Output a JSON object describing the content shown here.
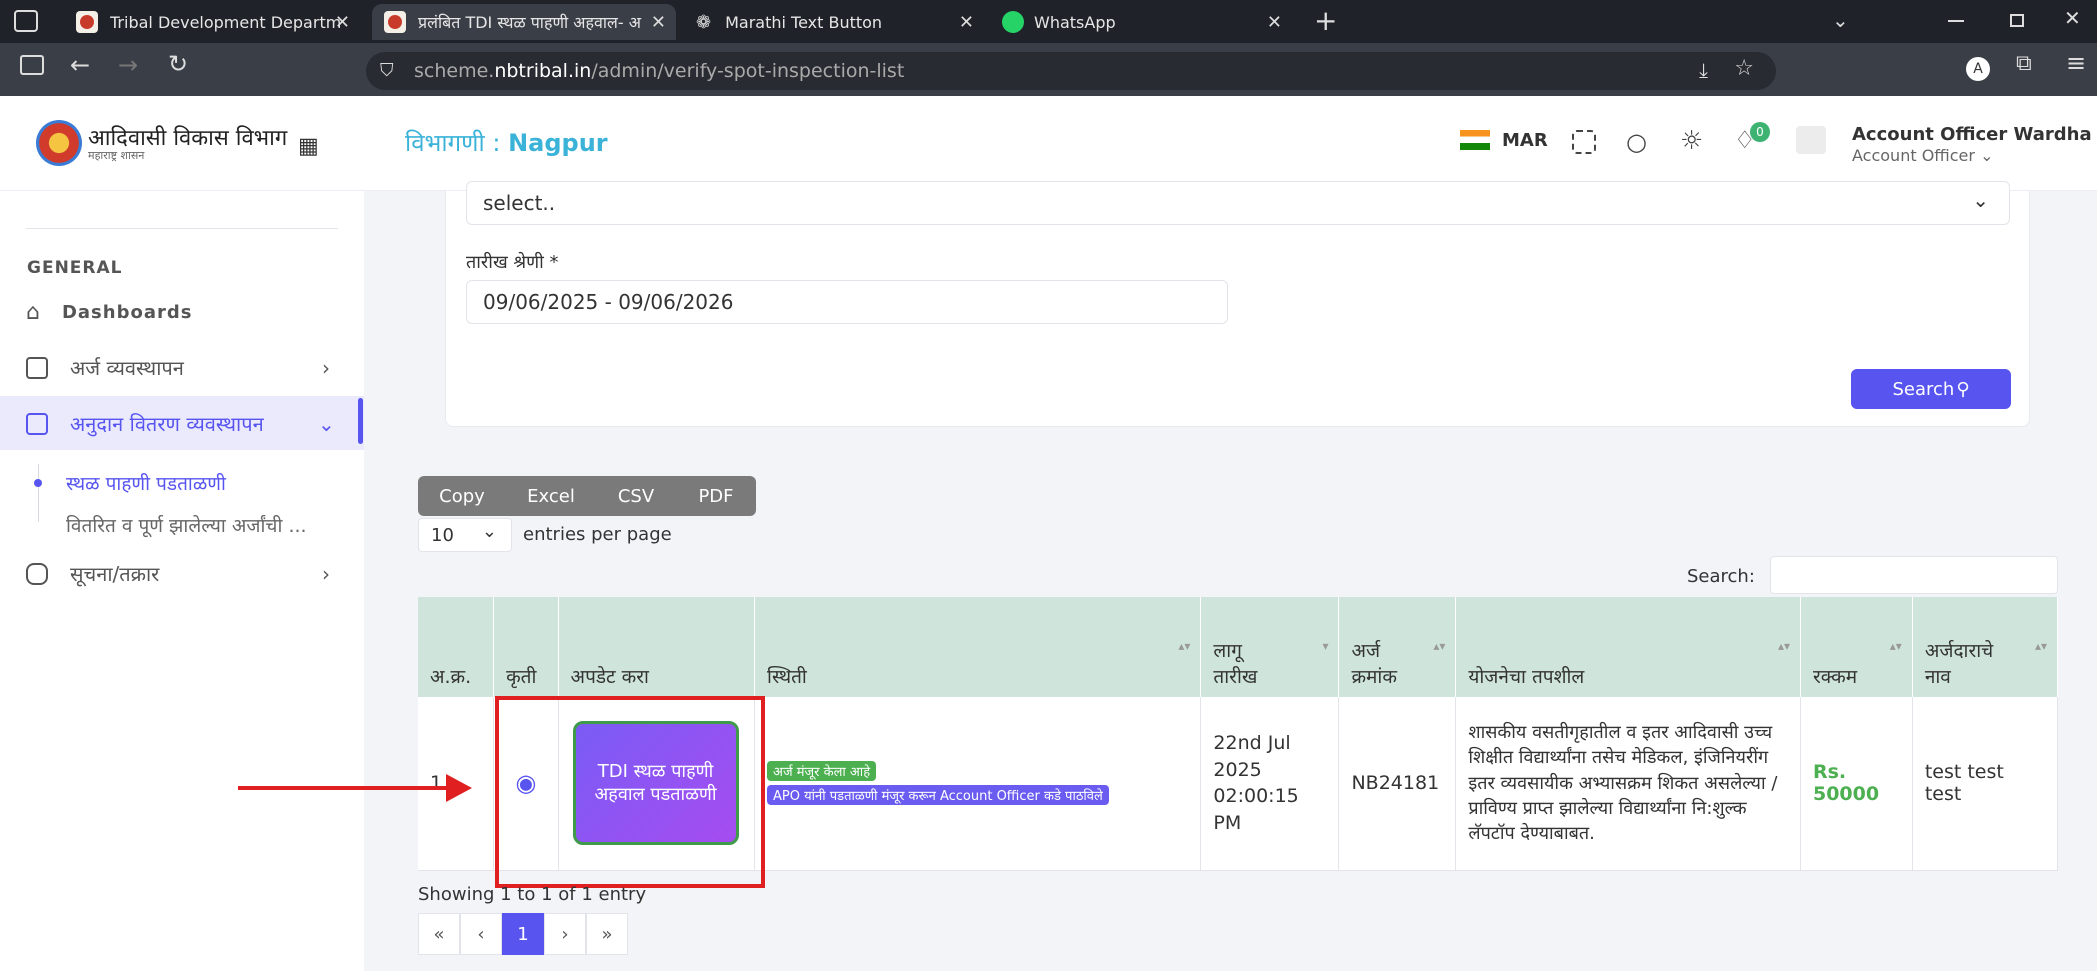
{
  "browser": {
    "tabs": [
      {
        "title": "Tribal Development Department"
      },
      {
        "title": "प्रलंबित TDI स्थळ पाहणी अहवाल- अ"
      },
      {
        "title": "Marathi Text Button"
      },
      {
        "title": "WhatsApp"
      }
    ],
    "new_tab": "+",
    "url_prefix": "scheme.",
    "url_domain": "nbtribal.in",
    "url_path": "/admin/verify-spot-inspection-list"
  },
  "header": {
    "logo_title": "आदिवासी विकास विभाग",
    "logo_subtitle": "महाराष्ट्र शासन",
    "division_label": "विभागणी : ",
    "division_value": "Nagpur",
    "language": "MAR",
    "notification_count": "0",
    "user_name": "Account Officer Wardha",
    "user_role": "Account Officer"
  },
  "sidebar": {
    "section": "GENERAL",
    "items": [
      {
        "label": "Dashboards"
      },
      {
        "label": "अर्ज व्यवस्थापन"
      },
      {
        "label": "अनुदान वितरण व्यवस्थापन"
      },
      {
        "label": "सूचना/तक्रार"
      }
    ],
    "sub_items": [
      {
        "label": "स्थळ पाहणी पडताळणी"
      },
      {
        "label": "वितरित व पूर्ण झालेल्या अर्जांची ..."
      }
    ]
  },
  "filters": {
    "select_value": "select..",
    "date_label": "तारीख श्रेणी *",
    "date_value": "09/06/2025 - 09/06/2026",
    "search_button": "Search"
  },
  "export_buttons": [
    "Copy",
    "Excel",
    "CSV",
    "PDF"
  ],
  "entries": {
    "value": "10",
    "label": "entries per page"
  },
  "search_label": "Search:",
  "table": {
    "headers": [
      "अ.क्र.",
      "कृती",
      "अपडेट करा",
      "स्थिती",
      "लागू तारीख",
      "अर्ज क्रमांक",
      "योजनेचा तपशील",
      "रक्कम",
      "अर्जदाराचे नाव"
    ],
    "row": {
      "index": "1",
      "update_button": "TDI स्थळ पाहणी अहवाल पडताळणी",
      "status_1": "अर्ज मंजूर केला आहे",
      "status_2": "APO यांनी पडताळणी मंजूर करून Account Officer कडे पाठविले",
      "date": "22nd Jul 2025 02:00:15 PM",
      "app_no": "NB24181",
      "scheme": "शासकीय वसतीगृहातील व इतर आदिवासी उच्च शिक्षीत विद्यार्थ्यांना तसेच मेडिकल, इंजिनियरींग इतर व्यवसायीक अभ्यासक्रम शिकत असलेल्या / प्राविण्य प्राप्त झालेल्या विद्यार्थ्यांना नि:शुल्क लॅपटॉप देण्याबाबत.",
      "amount": "Rs. 50000",
      "applicant": "test test test"
    }
  },
  "showing": "Showing 1 to 1 of 1 entry",
  "pagination": [
    "«",
    "‹",
    "1",
    "›",
    "»"
  ],
  "colors": {
    "accent": "#5754f0",
    "highlight": "#e02020",
    "green": "#4caf50"
  }
}
